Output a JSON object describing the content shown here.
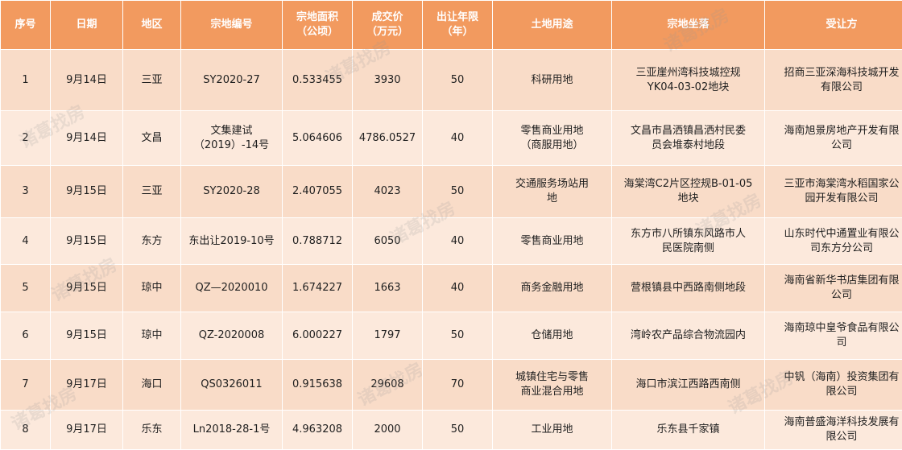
{
  "headers": [
    "序号",
    "日期",
    "地区",
    "宗地编号",
    "宗地面积\n（公顷）",
    "成交价\n（万元）",
    "出让年限\n（年）",
    "土地用途",
    "宗地坐落",
    "受让方"
  ],
  "rows": [
    {
      "no": "1",
      "date": "9月14日",
      "region": "三亚",
      "parcel": "SY2020-27",
      "area": "0.533455",
      "price": "3930",
      "years": "50",
      "use": "科研用地",
      "location": "三亚崖州湾科技城控规\nYK04-03-02地块",
      "buyer": "招商三亚深海科技城开发\n有限公司"
    },
    {
      "no": "2",
      "date": "9月14日",
      "region": "文昌",
      "parcel": "文集建试\n（2019）-14号",
      "area": "5.064606",
      "price": "4786.0527",
      "years": "40",
      "use": "零售商业用地\n（商服用地）",
      "location": "文昌市昌洒镇昌洒村民委\n员会堆泰村地段",
      "buyer": "海南旭景房地产开发有限\n公司"
    },
    {
      "no": "3",
      "date": "9月15日",
      "region": "三亚",
      "parcel": "SY2020-28",
      "area": "2.407055",
      "price": "4023",
      "years": "50",
      "use": "交通服务场站用\n地",
      "location": "海棠湾C2片区控规B-01-05\n地块",
      "buyer": "三亚市海棠湾水稻国家公\n园开发有限公司"
    },
    {
      "no": "4",
      "date": "9月15日",
      "region": "东方",
      "parcel": "东出让2019-10号",
      "area": "0.788712",
      "price": "6050",
      "years": "40",
      "use": "零售商业用地",
      "location": "东方市八所镇东风路市人\n民医院南侧",
      "buyer": "山东时代中通置业有限公\n司东方分公司"
    },
    {
      "no": "5",
      "date": "9月15日",
      "region": "琼中",
      "parcel": "QZ—2020010",
      "area": "1.674227",
      "price": "1663",
      "years": "40",
      "use": "商务金融用地",
      "location": "营根镇县中西路南侧地段",
      "buyer": "海南省新华书店集团有限\n公司"
    },
    {
      "no": "6",
      "date": "9月15日",
      "region": "琼中",
      "parcel": "QZ-2020008",
      "area": "6.000227",
      "price": "1797",
      "years": "50",
      "use": "仓储用地",
      "location": "湾岭农产品综合物流园内",
      "buyer": "海南琼中皇爷食品有限公\n司"
    },
    {
      "no": "7",
      "date": "9月17日",
      "region": "海口",
      "parcel": "QS0326011",
      "area": "0.915638",
      "price": "29608",
      "years": "70",
      "use": "城镇住宅与零售\n商业混合用地",
      "location": "海口市滨江西路西南侧",
      "buyer": "中钒（海南）投资集团有\n限公司"
    },
    {
      "no": "8",
      "date": "9月17日",
      "region": "乐东",
      "parcel": "Ln2018-28-1号",
      "area": "4.963208",
      "price": "2000",
      "years": "50",
      "use": "工业用地",
      "location": "乐东县千家镇",
      "buyer": "海南普盛海洋科技发展有\n限公司"
    }
  ],
  "watermark": "诸葛找房",
  "colors": {
    "header_bg": "#f29a5f",
    "row_bg": "#f9dcc8",
    "row_alt_bg": "#fce9dc"
  }
}
